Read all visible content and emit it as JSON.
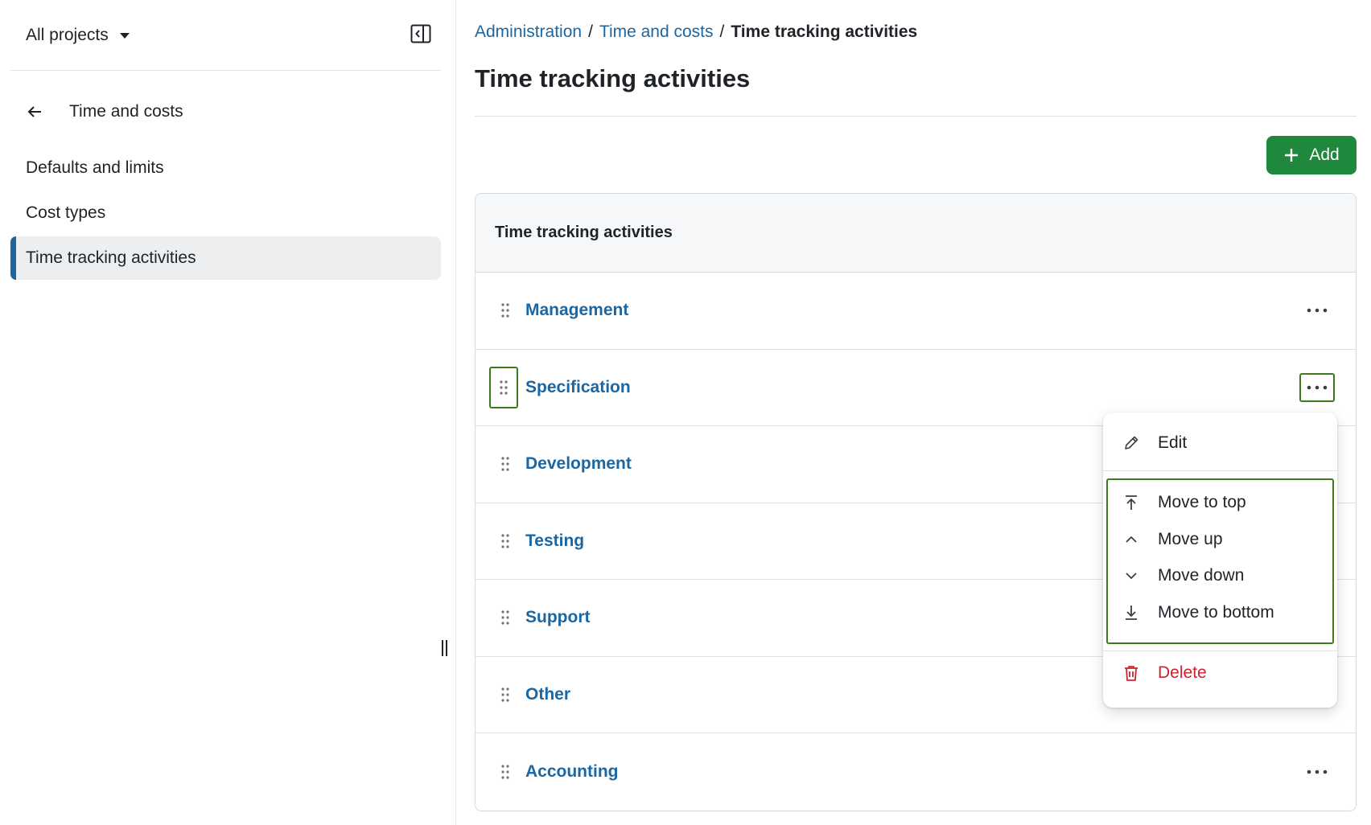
{
  "sidebar": {
    "project_selector": "All projects",
    "back_label": "Time and costs",
    "items": [
      {
        "label": "Defaults and limits"
      },
      {
        "label": "Cost types"
      },
      {
        "label": "Time tracking activities"
      }
    ]
  },
  "breadcrumb": {
    "items": [
      "Administration",
      "Time and costs"
    ],
    "current": "Time tracking activities",
    "separator": "/"
  },
  "page": {
    "title": "Time tracking activities",
    "add_label": "Add"
  },
  "table": {
    "header": "Time tracking activities",
    "rows": [
      {
        "label": "Management"
      },
      {
        "label": "Specification"
      },
      {
        "label": "Development"
      },
      {
        "label": "Testing"
      },
      {
        "label": "Support"
      },
      {
        "label": "Other"
      },
      {
        "label": "Accounting"
      }
    ]
  },
  "menu": {
    "edit": "Edit",
    "move_to_top": "Move to top",
    "move_up": "Move up",
    "move_down": "Move down",
    "move_to_bottom": "Move to bottom",
    "delete": "Delete"
  },
  "colors": {
    "link": "#1a67a3",
    "primary_button": "#1f883d",
    "danger": "#cf222e",
    "highlight_outline": "#3d7a1e",
    "active_indicator": "#1a67a3"
  }
}
